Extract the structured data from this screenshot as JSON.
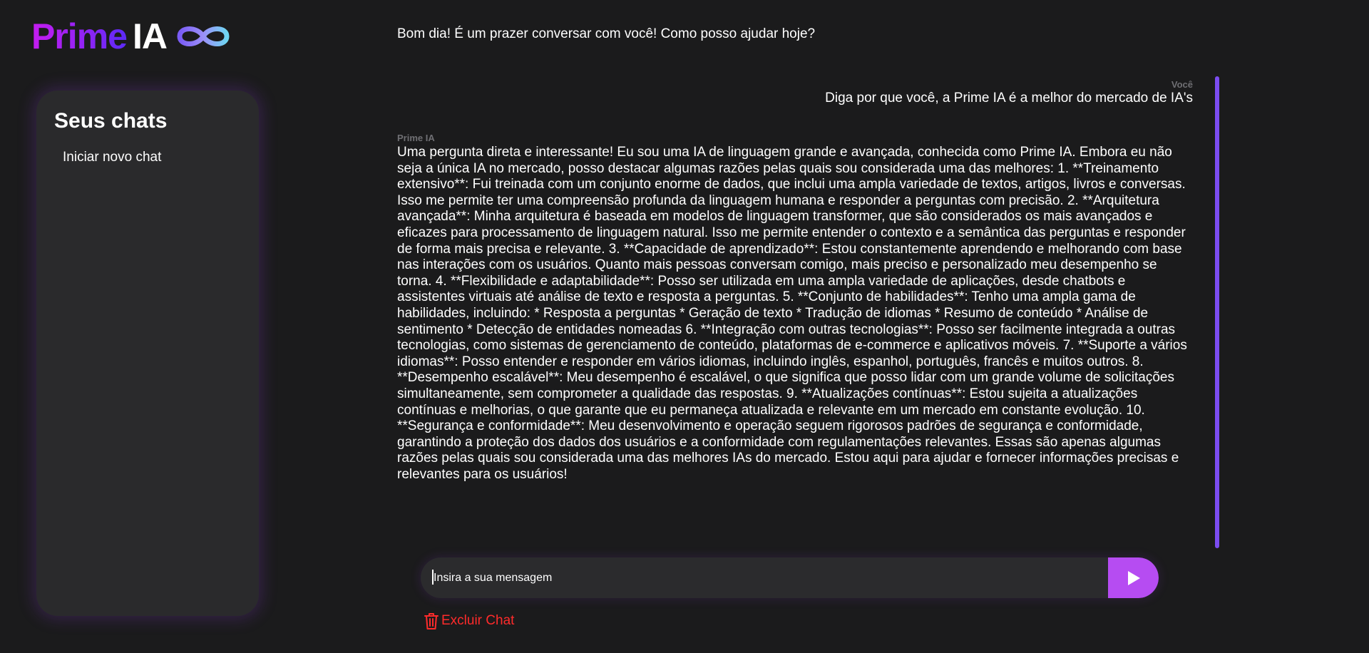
{
  "app": {
    "logo_text_1": "Prime",
    "logo_text_2": "IA",
    "logo_icon": "infinity-icon"
  },
  "sidebar": {
    "title": "Seus chats",
    "items": [
      {
        "label": "Iniciar novo chat"
      }
    ]
  },
  "greeting": "Bom dia! É um prazer conversar com você! Como posso ajudar hoje?",
  "messages": [
    {
      "sender": "Você",
      "text": "Diga por que você, a Prime IA é a melhor do mercado de IA's"
    },
    {
      "sender": "Prime IA",
      "text": "Uma pergunta direta e interessante! Eu sou uma IA de linguagem grande e avançada, conhecida como Prime IA. Embora eu não seja a única IA no mercado, posso destacar algumas razões pelas quais sou considerada uma das melhores: 1. **Treinamento extensivo**: Fui treinada com um conjunto enorme de dados, que inclui uma ampla variedade de textos, artigos, livros e conversas. Isso me permite ter uma compreensão profunda da linguagem humana e responder a perguntas com precisão. 2. **Arquitetura avançada**: Minha arquitetura é baseada em modelos de linguagem transformer, que são considerados os mais avançados e eficazes para processamento de linguagem natural. Isso me permite entender o contexto e a semântica das perguntas e responder de forma mais precisa e relevante. 3. **Capacidade de aprendizado**: Estou constantemente aprendendo e melhorando com base nas interações com os usuários. Quanto mais pessoas conversam comigo, mais preciso e personalizado meu desempenho se torna. 4. **Flexibilidade e adaptabilidade**: Posso ser utilizada em uma ampla variedade de aplicações, desde chatbots e assistentes virtuais até análise de texto e resposta a perguntas. 5. **Conjunto de habilidades**: Tenho uma ampla gama de habilidades, incluindo: * Resposta a perguntas * Geração de texto * Tradução de idiomas * Resumo de conteúdo * Análise de sentimento * Detecção de entidades nomeadas 6. **Integração com outras tecnologias**: Posso ser facilmente integrada a outras tecnologias, como sistemas de gerenciamento de conteúdo, plataformas de e-commerce e aplicativos móveis. 7. **Suporte a vários idiomas**: Posso entender e responder em vários idiomas, incluindo inglês, espanhol, português, francês e muitos outros. 8. **Desempenho escalável**: Meu desempenho é escalável, o que significa que posso lidar com um grande volume de solicitações simultaneamente, sem comprometer a qualidade das respostas. 9. **Atualizações contínuas**: Estou sujeita a atualizações contínuas e melhorias, o que garante que eu permaneça atualizada e relevante em um mercado em constante evolução. 10. **Segurança e conformidade**: Meu desenvolvimento e operação seguem rigorosos padrões de segurança e conformidade, garantindo a proteção dos dados dos usuários e a conformidade com regulamentações relevantes. Essas são apenas algumas razões pelas quais sou considerada uma das melhores IAs do mercado. Estou aqui para ajudar e fornecer informações precisas e relevantes para os usuários!"
    }
  ],
  "input": {
    "placeholder": "Insira a sua mensagem",
    "value": ""
  },
  "send_button": {
    "icon": "play-icon"
  },
  "delete_button": {
    "label": "Excluir Chat",
    "icon": "trash-icon"
  },
  "colors": {
    "background": "#1b1b1c",
    "sidebar": "#2a2a2c",
    "accent_purple": "#b64cf2",
    "scrollbar": "#7b4cf0",
    "danger": "#ff2b2b"
  }
}
